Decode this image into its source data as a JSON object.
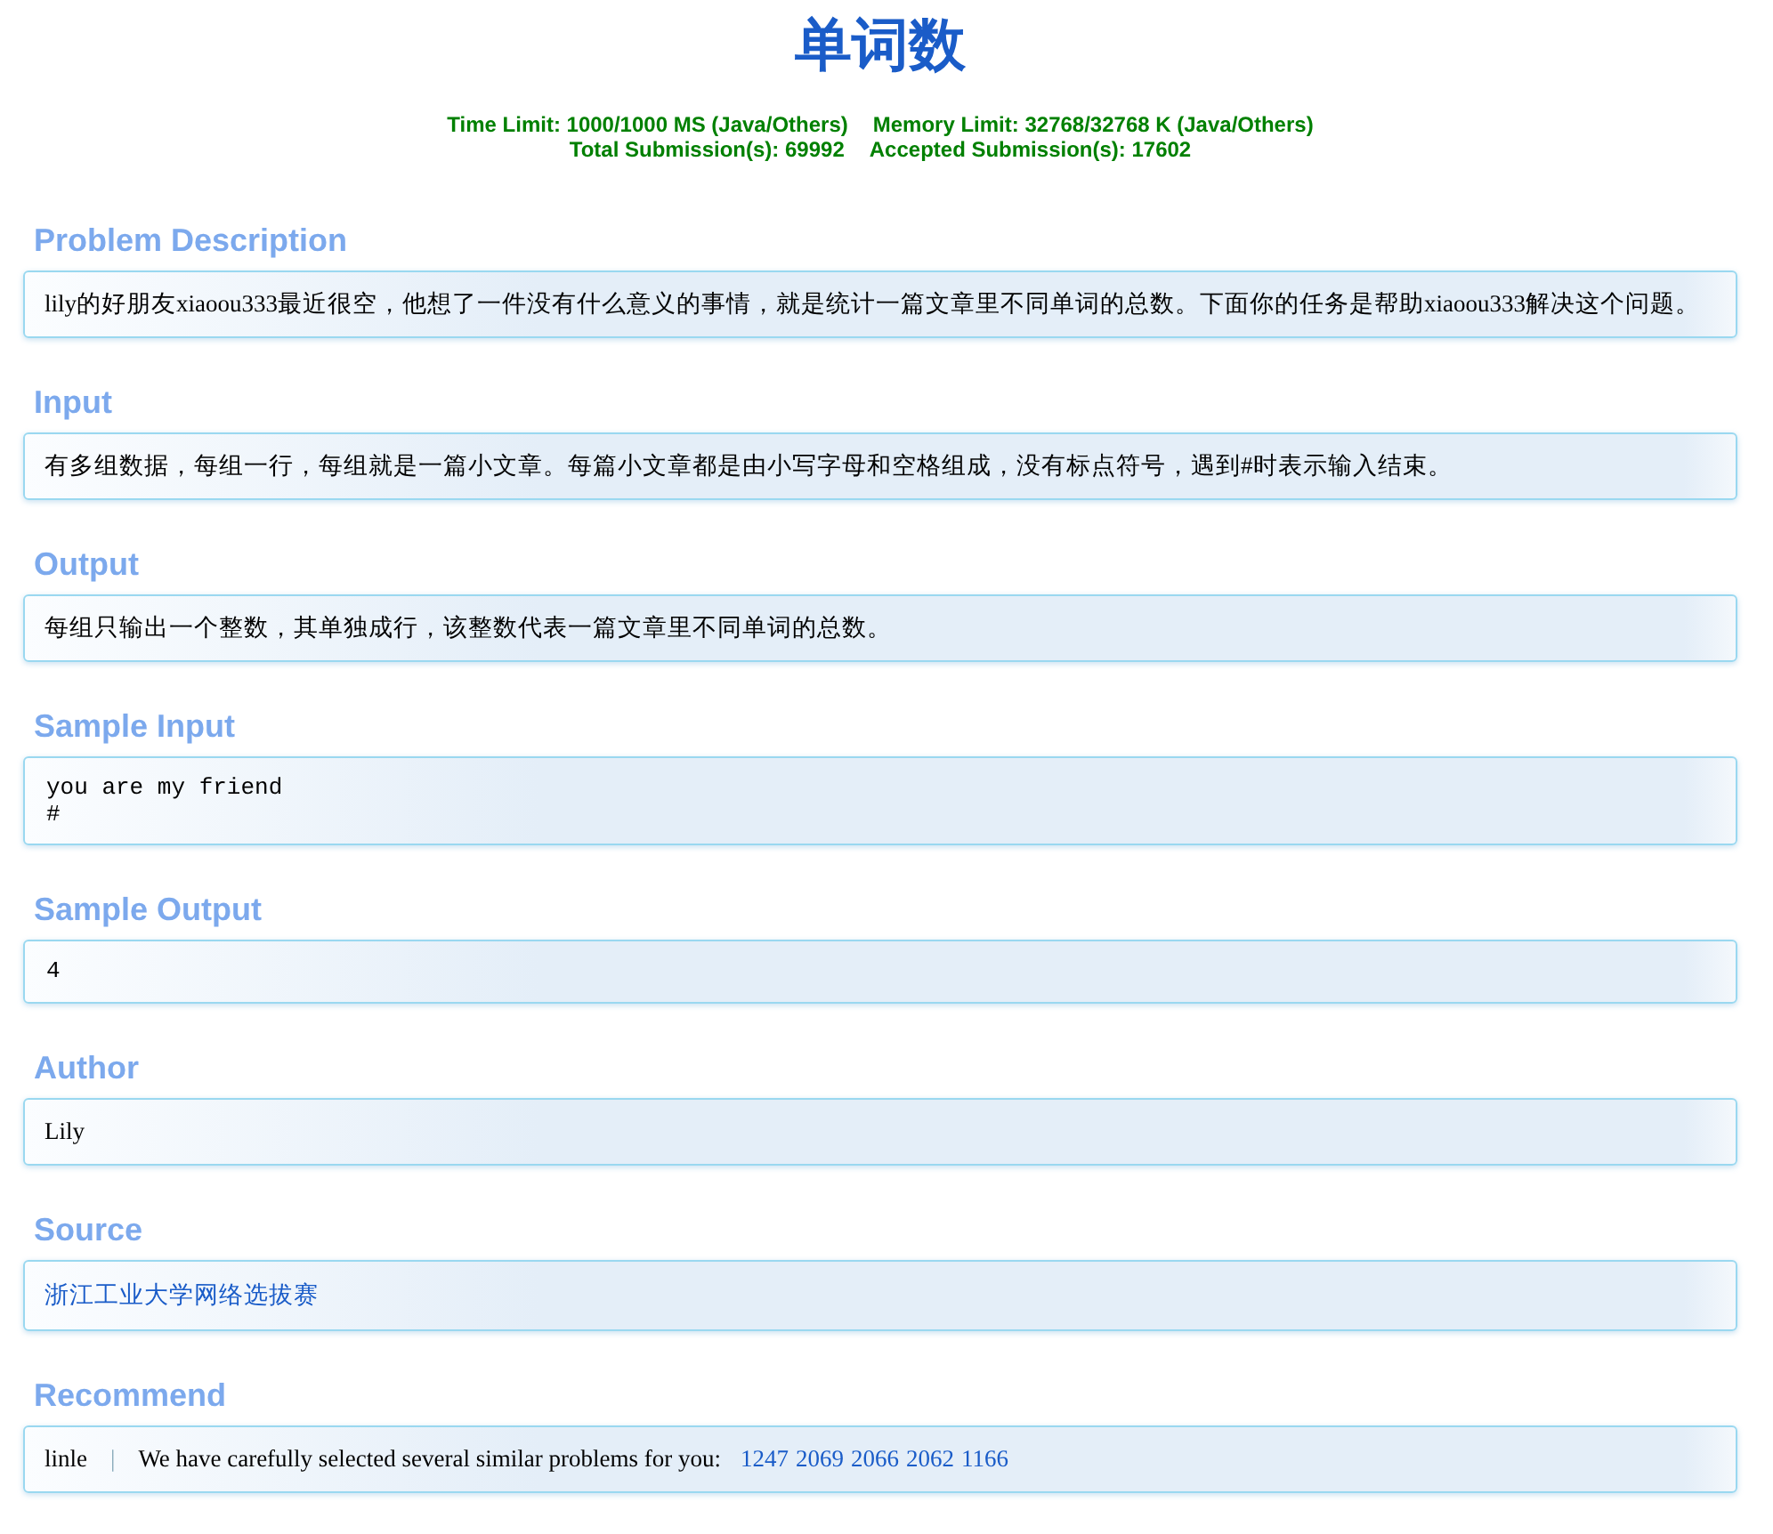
{
  "title": "单词数",
  "limits": [
    "Time Limit: 1000/1000 MS (Java/Others)",
    "Memory Limit: 32768/32768 K (Java/Others)"
  ],
  "submissions": [
    "Total Submission(s): 69992",
    "Accepted Submission(s): 17602"
  ],
  "sections": [
    {
      "heading": "Problem Description",
      "kind": "text",
      "lines": [
        "lily的好朋友xiaoou333最近很空，他想了一件没有什么意义的事情，就是统计一篇文章里不同单词的总数。下面你的任务是帮助xiaoou333解决这个问题。"
      ]
    },
    {
      "heading": "Input",
      "kind": "text",
      "lines": [
        "有多组数据，每组一行，每组就是一篇小文章。每篇小文章都是由小写字母和空格组成，没有标点符号，遇到#时表示输入结束。"
      ]
    },
    {
      "heading": "Output",
      "kind": "text",
      "lines": [
        "每组只输出一个整数，其单独成行，该整数代表一篇文章里不同单词的总数。"
      ]
    },
    {
      "heading": "Sample Input",
      "kind": "code",
      "lines": [
        "you are my friend",
        "#"
      ]
    },
    {
      "heading": "Sample Output",
      "kind": "code",
      "lines": [
        "4"
      ]
    },
    {
      "heading": "Author",
      "kind": "text",
      "lines": [
        "Lily"
      ]
    },
    {
      "heading": "Source",
      "kind": "link",
      "lines": [
        "浙江工业大学网络选拔赛"
      ]
    },
    {
      "heading": "Recommend",
      "kind": "recommend",
      "lines": [
        "linle",
        "|",
        "We have carefully selected several similar problems for you:"
      ],
      "links": [
        "1247",
        "2069",
        "2066",
        "2062",
        "1166"
      ]
    }
  ]
}
